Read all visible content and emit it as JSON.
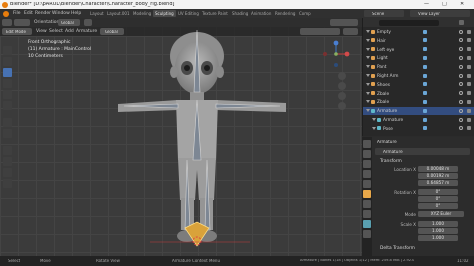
{
  "window": {
    "title": "Blender* [D:\\pARUL\\Blender\\Character\\Character_body_rig.blend]",
    "controls": [
      "—",
      "□",
      "✕"
    ]
  },
  "menubar": {
    "menus": [
      "File",
      "Edit",
      "Render",
      "Window",
      "Help"
    ],
    "workspaces": [
      "Layout",
      "Layout.001",
      "Modeling",
      "Sculpting",
      "UV Editing",
      "Texture Paint",
      "Shading",
      "Animation",
      "Rendering",
      "Comp"
    ],
    "active_workspace": "Sculpting",
    "scene_label": "Scene",
    "view_layer_label": "View Layer"
  },
  "viewport_header": {
    "transform_orientation": "Orientation",
    "orientation_value": "Global",
    "mode": "Edit Mode",
    "view_menu": "View",
    "select_menu": "Select",
    "add_menu": "Add",
    "armature_menu": "Armature",
    "pivot": "Global"
  },
  "viewport_overlay": {
    "view_name": "Front Orthographic",
    "object_info": "(11) Armature : MainControl",
    "scale_info": "10 Centimeters"
  },
  "outliner": {
    "rows": [
      {
        "label": "Empty",
        "icon_color": "#e0a050"
      },
      {
        "label": "Hair",
        "icon_color": "#e0a050"
      },
      {
        "label": "Left eye",
        "icon_color": "#e0a050"
      },
      {
        "label": "Light",
        "icon_color": "#e0a050"
      },
      {
        "label": "Pant",
        "icon_color": "#e0a050"
      },
      {
        "label": "Right Arm",
        "icon_color": "#e0a050"
      },
      {
        "label": "Shoes",
        "icon_color": "#e0a050"
      },
      {
        "label": "Zbale",
        "icon_color": "#e0a050"
      },
      {
        "label": "Zbale",
        "icon_color": "#e0a050"
      },
      {
        "label": "Armature",
        "icon_color": "#5fb8c8"
      },
      {
        "label": "Armature",
        "icon_color": "#5fb8c8"
      },
      {
        "label": "Pose",
        "icon_color": "#5fb8c8"
      }
    ]
  },
  "properties": {
    "object_name": "Armature",
    "context_name": "Armature",
    "transform_section": "Transform",
    "location_label": "Location X",
    "location": [
      "0.00048 m",
      "0.00192 m",
      "0.64857 m"
    ],
    "rotation_label": "Rotation X",
    "rotation": [
      "0°",
      "0°",
      "0°"
    ],
    "mode_label": "Mode",
    "mode_value": "XYZ Euler",
    "scale_label": "Scale X",
    "scale": [
      "1.000",
      "1.000",
      "1.000"
    ],
    "delta_section": "Delta Transform"
  },
  "statusbar": {
    "select": "Select",
    "move": "Move",
    "rotate_view": "Rotate View",
    "context_menu": "Armature Context Menu",
    "stats": "Armature | Bones 1/18 | Objects 1/12 | Mem: 259.8 MiB | 2.92.0",
    "clock": "11:02"
  }
}
